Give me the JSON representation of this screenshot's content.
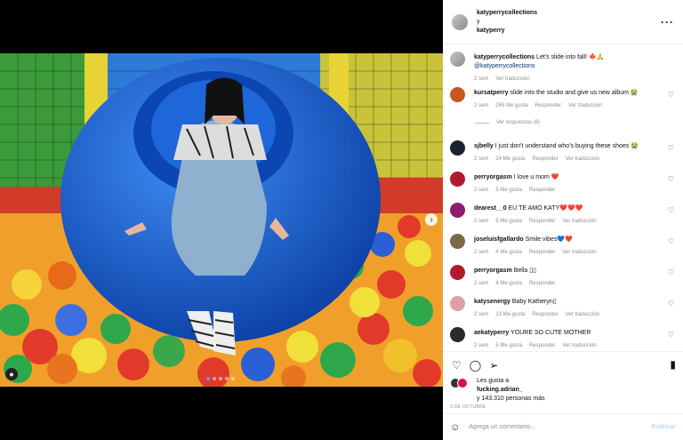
{
  "header": {
    "user1": "katyperrycollections",
    "joiner": "y",
    "user2": "katyperry",
    "more_icon": "more-horizontal-icon"
  },
  "caption": {
    "user": "katyperrycollections",
    "text": "Let's slide into fall! 🍁🙏",
    "mention": "@katyperrycollections",
    "time": "2 sem",
    "translate": "Ver traducción"
  },
  "comments": [
    {
      "user": "kursatperry",
      "text": "slide into the studio and give us new album 😭",
      "time": "2 sem",
      "likes": "265 Me gusta",
      "reply": "Responder",
      "translate": "Ver traducción",
      "avatar_color": "#c8561f"
    },
    {
      "user": "sjbelly",
      "text": "I just don't understand who's buying these shoes 😭",
      "time": "2 sem",
      "likes": "14 Me gusta",
      "reply": "Responder",
      "translate": "Ver traducción",
      "avatar_color": "#1b2230"
    },
    {
      "user": "perryorgasm",
      "text": "I love u mom ❤️",
      "time": "2 sem",
      "likes": "5 Me gusta",
      "reply": "Responder",
      "translate": "",
      "avatar_color": "#b01c2f"
    },
    {
      "user": "dearest__0",
      "text": "EU TE AMO KATY❤️❤️❤️",
      "time": "2 sem",
      "likes": "5 Me gusta",
      "reply": "Responder",
      "translate": "Ver traducción",
      "avatar_color": "#8a1f6b"
    },
    {
      "user": "joseluisfgallardo",
      "text": "Smile vibes💙❤️",
      "time": "2 sem",
      "likes": "4 Me gusta",
      "reply": "Responder",
      "translate": "Ver traducción",
      "avatar_color": "#7a6a4a"
    },
    {
      "user": "perryorgasm",
      "text": "Bella ▯▯",
      "time": "2 sem",
      "likes": "4 Me gusta",
      "reply": "Responder",
      "translate": "",
      "avatar_color": "#b01c2f"
    },
    {
      "user": "katysenergy",
      "text": "Baby Katheryn▯",
      "time": "2 sem",
      "likes": "13 Me gusta",
      "reply": "Responder",
      "translate": "Ver traducción",
      "avatar_color": "#d9a3a0"
    },
    {
      "user": "aekatyperry",
      "text": "YOURE SO CUTE MOTHER",
      "time": "2 sem",
      "likes": "5 Me gusta",
      "reply": "Responder",
      "translate": "Ver traducción",
      "avatar_color": "#2a2a2a"
    }
  ],
  "view_replies": "Ver respuestas (6)",
  "actions": {
    "like_icon": "heart-icon",
    "comment_icon": "comment-icon",
    "share_icon": "send-icon",
    "save_icon": "bookmark-icon"
  },
  "likes": {
    "prefix": "Les gusta a",
    "user": "fucking.adrian_",
    "suffix": "y 143.310 personas más"
  },
  "date": "3 DE OCTUBRE",
  "add_comment": {
    "placeholder": "Agrega un comentario...",
    "publish": "Publicar",
    "emoji_icon": "smiley-icon"
  },
  "colors": {
    "link": "#00376b",
    "muted": "#8e8e8e",
    "publish_disabled": "#b2dffc"
  }
}
